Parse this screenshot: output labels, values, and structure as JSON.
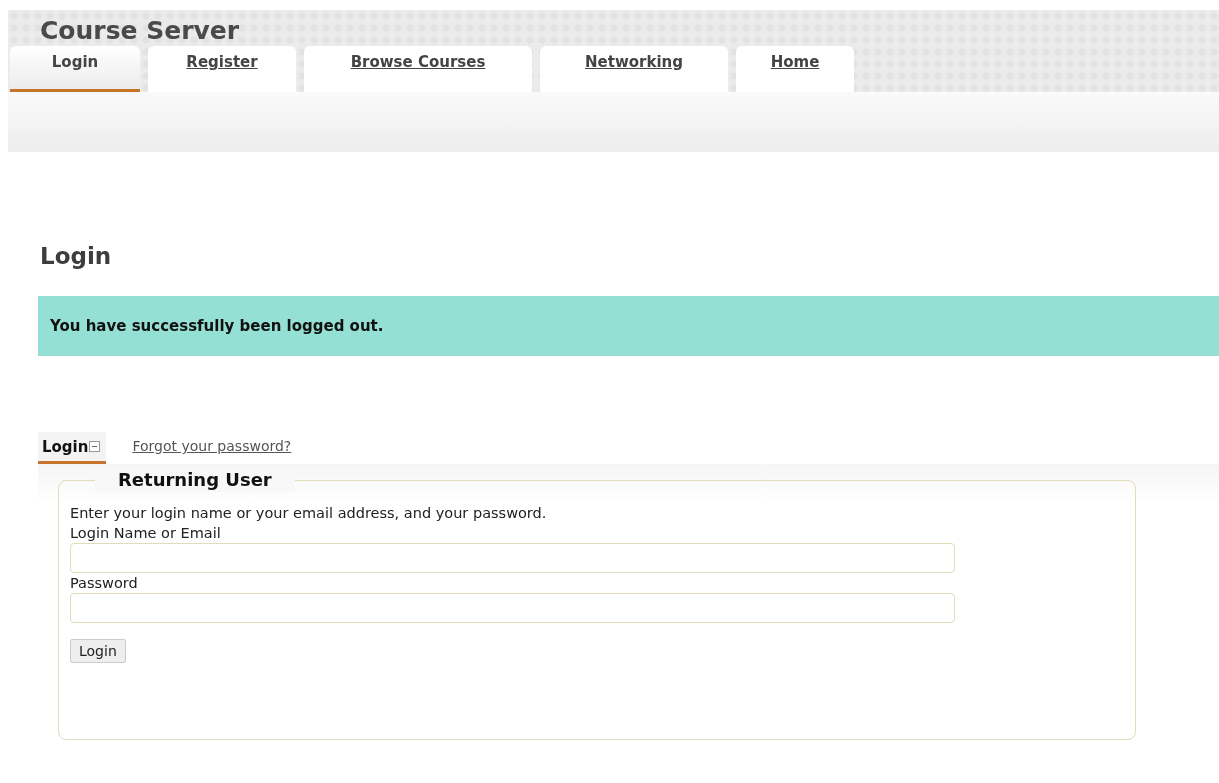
{
  "site": {
    "title": "Course Server"
  },
  "nav_tabs": [
    {
      "label": "Login",
      "selected": true
    },
    {
      "label": "Register",
      "selected": false
    },
    {
      "label": "Browse Courses",
      "selected": false
    },
    {
      "label": "Networking",
      "selected": false
    },
    {
      "label": "Home",
      "selected": false
    }
  ],
  "page_heading": "Login",
  "message": "You have successfully been logged out.",
  "form_tabs": [
    {
      "label": "Login",
      "selected": true
    },
    {
      "label": "Forgot your password?",
      "selected": false
    }
  ],
  "fieldset": {
    "legend": "Returning User",
    "instructions": "Enter your login name or your email address, and your password.",
    "fields": [
      {
        "label": "Login Name or Email"
      },
      {
        "label": "Password"
      }
    ],
    "submit": "Login"
  }
}
